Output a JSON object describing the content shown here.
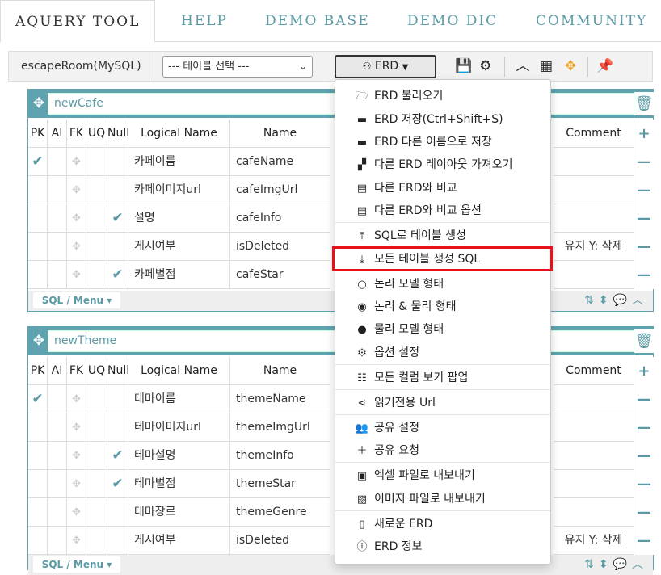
{
  "nav": {
    "tabs": [
      "AQUERY TOOL",
      "HELP",
      "DEMO BASE",
      "DEMO DIC",
      "COMMUNITY"
    ]
  },
  "toolbar": {
    "db_name": "escapeRoom(MySQL)",
    "table_select": "--- 테이블 선택 ---",
    "erd_button": "ERD"
  },
  "columns": [
    "PK",
    "AI",
    "FK",
    "UQ",
    "Null",
    "Logical Name",
    "Name",
    "Comment"
  ],
  "tables": [
    {
      "name": "newCafe",
      "rows": [
        {
          "pk": true,
          "null": false,
          "logical": "카페이름",
          "name": "cafeName",
          "comment": ""
        },
        {
          "pk": false,
          "null": false,
          "logical": "카페이미지url",
          "name": "cafeImgUrl",
          "comment": ""
        },
        {
          "pk": false,
          "null": true,
          "logical": "설명",
          "name": "cafeInfo",
          "comment": ""
        },
        {
          "pk": false,
          "null": false,
          "logical": "게시여부",
          "name": "isDeleted",
          "comment": "유지 Y: 삭제"
        },
        {
          "pk": false,
          "null": true,
          "logical": "카페별점",
          "name": "cafeStar",
          "comment": ""
        }
      ]
    },
    {
      "name": "newTheme",
      "rows": [
        {
          "pk": true,
          "null": false,
          "logical": "테마이름",
          "name": "themeName",
          "comment": ""
        },
        {
          "pk": false,
          "null": false,
          "logical": "테마이미지url",
          "name": "themeImgUrl",
          "comment": ""
        },
        {
          "pk": false,
          "null": true,
          "logical": "테마설명",
          "name": "themeInfo",
          "comment": ""
        },
        {
          "pk": false,
          "null": true,
          "logical": "테마별점",
          "name": "themeStar",
          "comment": ""
        },
        {
          "pk": false,
          "null": false,
          "logical": "테마장르",
          "name": "themeGenre",
          "comment": ""
        },
        {
          "pk": false,
          "null": false,
          "logical": "게시여부",
          "name": "isDeleted",
          "comment": "유지 Y: 삭제"
        }
      ]
    }
  ],
  "sql_menu": "SQL / Menu",
  "menu": [
    {
      "label": "ERD 불러오기",
      "icon": "folder-open-icon",
      "glyph": "🗁"
    },
    {
      "label": "ERD 저장(Ctrl+Shift+S)",
      "icon": "save-icon",
      "glyph": "▬"
    },
    {
      "label": "ERD 다른 이름으로 저장",
      "icon": "save-as-icon",
      "glyph": "▬"
    },
    {
      "label": "다른 ERD 레이아웃 가져오기",
      "icon": "layout-icon",
      "glyph": "▞"
    },
    {
      "label": "다른 ERD와 비교",
      "icon": "compare-icon",
      "glyph": "▤"
    },
    {
      "label": "다른 ERD와 비교 옵션",
      "icon": "compare-option-icon",
      "glyph": "▤"
    },
    {
      "label": "SQL로 테이블 생성",
      "icon": "upload-icon",
      "glyph": "⤒"
    },
    {
      "label": "모든 테이블 생성 SQL",
      "icon": "download-icon",
      "glyph": "⤓"
    },
    {
      "label": "논리 모델 형태",
      "icon": "circle-empty-icon",
      "glyph": "○"
    },
    {
      "label": "논리 & 물리 형태",
      "icon": "circle-dot-icon",
      "glyph": "◉"
    },
    {
      "label": "물리 모델 형태",
      "icon": "circle-filled-icon",
      "glyph": "●"
    },
    {
      "label": "옵션 설정",
      "icon": "gear-icon",
      "glyph": "⚙"
    },
    {
      "label": "모든 컬럼 보기 팝업",
      "icon": "list-icon",
      "glyph": "☷"
    },
    {
      "label": "읽기전용 Url",
      "icon": "share-icon",
      "glyph": "⋖"
    },
    {
      "label": "공유 설정",
      "icon": "users-icon",
      "glyph": "👥"
    },
    {
      "label": "공유 요청",
      "icon": "user-plus-icon",
      "glyph": "＋"
    },
    {
      "label": "엑셀 파일로 내보내기",
      "icon": "excel-icon",
      "glyph": "▣"
    },
    {
      "label": "이미지 파일로 내보내기",
      "icon": "image-icon",
      "glyph": "▨"
    },
    {
      "label": "새로운 ERD",
      "icon": "new-file-icon",
      "glyph": "▯"
    },
    {
      "label": "ERD 정보",
      "icon": "info-icon",
      "glyph": "ⓘ"
    }
  ],
  "colors": {
    "accent": "#5fa3b1",
    "highlight": "#e5111b"
  }
}
